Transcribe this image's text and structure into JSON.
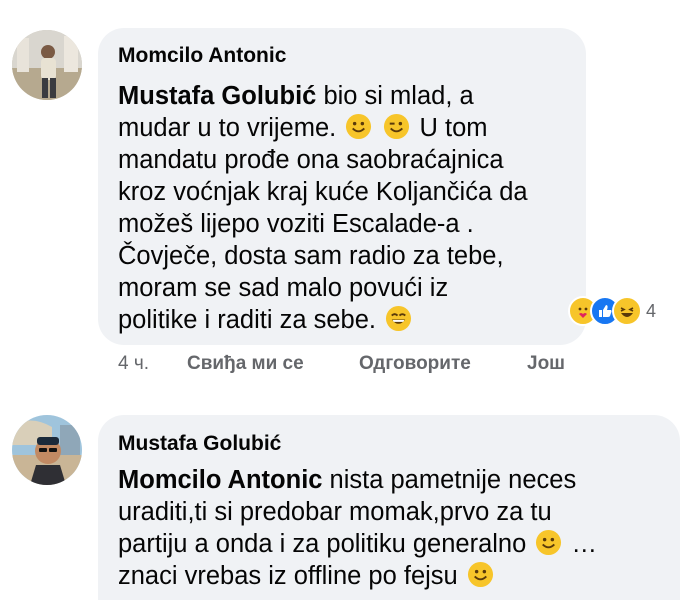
{
  "comments": [
    {
      "author": "Momcilo Antonic",
      "mention": "Mustafa Golubić",
      "line1_rest": " bio si mlad, a",
      "line2a": "mudar u to vrijeme.",
      "line2b": "U tom",
      "line3": "mandatu prođe ona saobraćajnica",
      "line4": "kroz voćnjak kraj kuće Koljančića da",
      "line5": "možeš lijepo voziti Escalade-a .",
      "line6": "Čovječe, dosta sam radio za tebe,",
      "line7": "moram se sad malo povući iz",
      "line8": "politike i raditi za sebe.",
      "reaction_count": "4",
      "reactions": [
        "care-icon",
        "like-icon",
        "haha-icon"
      ],
      "time": "4 ч.",
      "actions": {
        "like": "Свиђа ми се",
        "reply": "Одговорите",
        "more": "Још"
      }
    },
    {
      "author": "Mustafa Golubić",
      "mention": "Momcilo Antonic",
      "line1_rest": " nista pametnije neces",
      "line2": "uraditi,ti si predobar momak,prvo za tu",
      "line3a": "partiju a onda i za politiku generalno",
      "line3b": "…",
      "line4": "znaci vrebas iz offline po fejsu"
    }
  ],
  "colors": {
    "bubble": "#f0f2f5",
    "meta": "#65676b",
    "like_blue": "#1877f2",
    "emoji_yellow": "#f7c52a"
  }
}
